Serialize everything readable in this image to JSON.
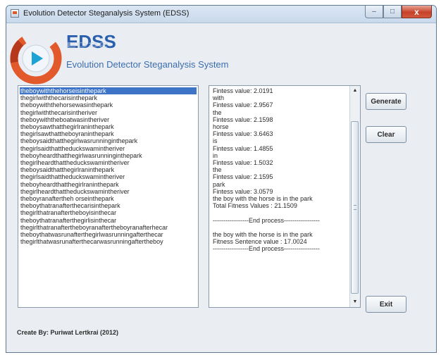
{
  "window": {
    "title": "Evolution Detector Steganalysis System (EDSS)",
    "controls": {
      "minimize": "–",
      "maximize": "□",
      "close": "x"
    }
  },
  "logo": {
    "title": "EDSS",
    "subtitle": "Evolution Detector Steganalysis System",
    "colors": {
      "orange": "#e2592c",
      "blue": "#2a5fae",
      "teal": "#1aa3d4"
    }
  },
  "sentence_list": {
    "selected_index": 0,
    "items": [
      "theboywiththehorseisinthepark",
      "thegirlwiththecarisinthepark",
      "theboywiththehorsewasinthepark",
      "thegirlwiththecarisintheriver",
      "theboywiththeboatwasintheriver",
      "theboysawthatthegirlraninthepark",
      "thegirlsawthattheboyraninthepark",
      "theboysaidthatthegirlwasrunninginthepark",
      "thegirlsaidthattheduckswamintheriver",
      "theboyheardthatthegirlwasrunninginthepark",
      "thegirlheardthattheduckswamintheriver",
      "theboysaidthatthegirlraninthepark",
      "thegirlsaidthattheduckswamintheriver",
      "theboyheardthatthegirlraninthepark",
      "thegirlheardthattheduckswamintheriver",
      "theboyranaftertheh orseinthepark",
      "theboythatranafterthecarisinthepark",
      "thegirlthatranaftertheboyisinthecar",
      "theboythatranafterthegirlisinthecar",
      "thegirlthatranaftertheboyranaftertheboyranafterhecar",
      "theboythatwasrunafterthegirlwasrunningafterthecar",
      "thegirlthatwasrunafterthecarwasrunningaftertheboy"
    ]
  },
  "log": {
    "lines": [
      "Fintess value: 2.0191",
      "with",
      "Fintess value: 2.9567",
      "the",
      "Fintess value: 2.1598",
      "horse",
      "Fintess value: 3.6463",
      "is",
      "Fintess value: 1.4855",
      "in",
      "Fintess value: 1.5032",
      "the",
      "Fintess value: 2.1595",
      "park",
      "Fintess value: 3.0579",
      "the boy with the horse is in the park",
      "Total Fitness Values : 21.1509",
      "",
      "-----------------End process-----------------",
      "",
      "the boy with the horse is in the park",
      "Fitness Sentence value : 17.0024",
      "-----------------End process-----------------"
    ]
  },
  "buttons": {
    "generate": "Generate",
    "clear": "Clear",
    "exit": "Exit"
  },
  "footer": {
    "credit": "Create By: Puriwat Lertkrai (2012)"
  }
}
